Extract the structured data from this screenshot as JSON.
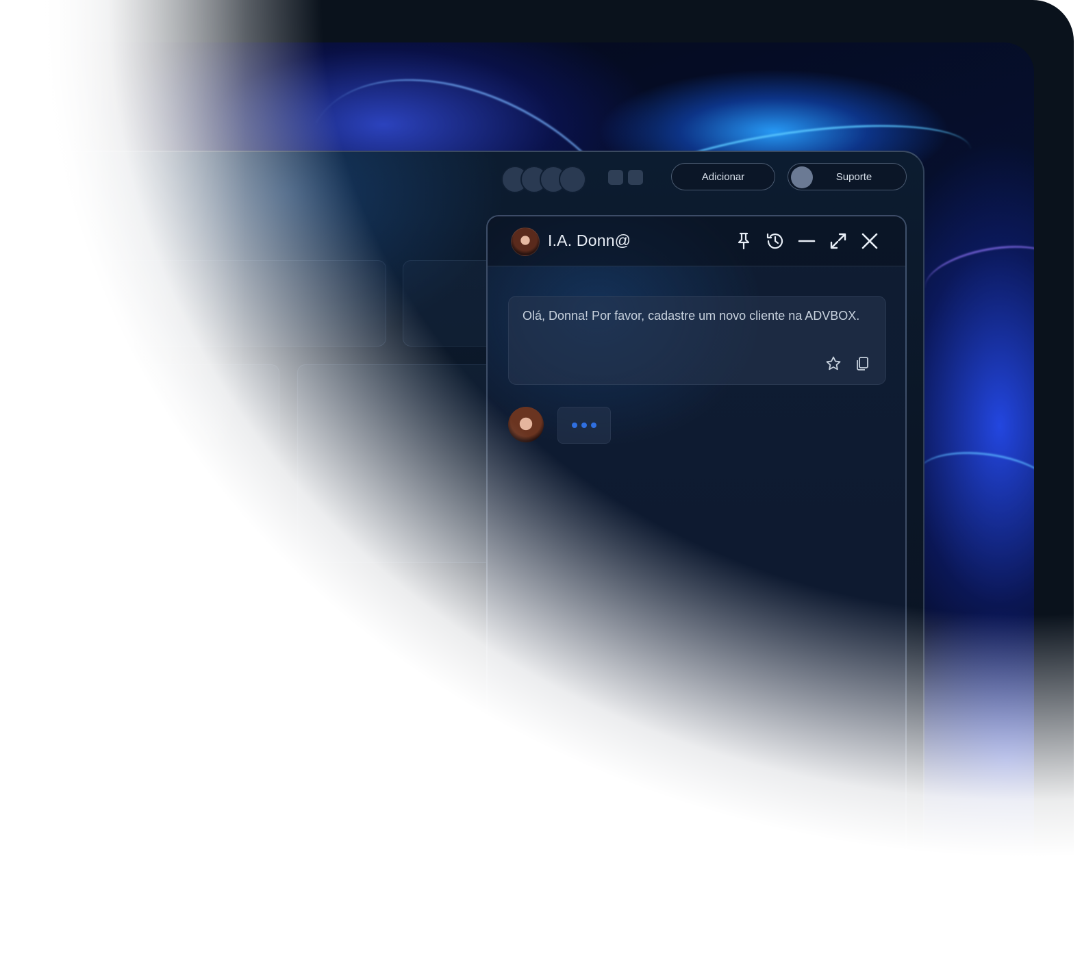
{
  "toolbar": {
    "add_label": "Adicionar",
    "support_label": "Suporte"
  },
  "chat": {
    "title": "I.A. Donn@",
    "header_icons": [
      "pin-icon",
      "history-icon",
      "minimize-icon",
      "expand-icon",
      "close-icon"
    ],
    "messages": [
      {
        "role": "user",
        "text": "Olá, Donna! Por favor, cadastre um novo cliente na ADVBOX.",
        "actions": [
          "star-icon",
          "copy-icon"
        ]
      }
    ],
    "typing_indicator": "typing-dots"
  },
  "colors": {
    "accent": "#2f6fe0",
    "panel": "#0f1d33",
    "text": "#c8d2de"
  }
}
